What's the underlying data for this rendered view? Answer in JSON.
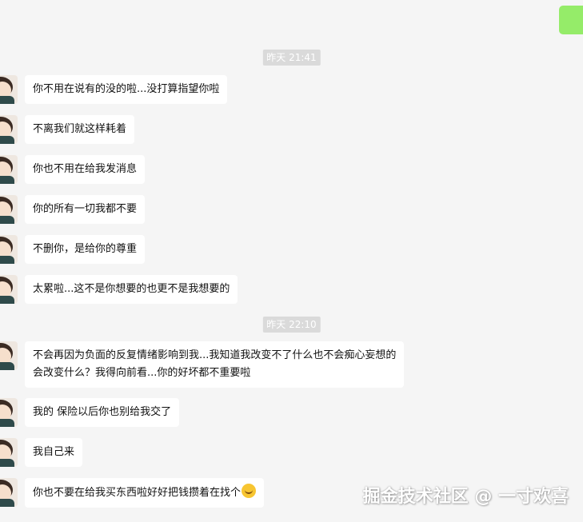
{
  "timestamps": [
    "昨天 21:41",
    "昨天 22:10"
  ],
  "messages": [
    {
      "text": "你不用在说有的没的啦...没打算指望你啦"
    },
    {
      "text": "不离我们就这样耗着"
    },
    {
      "text": "你也不用在给我发消息"
    },
    {
      "text": "你的所有一切我都不要"
    },
    {
      "text": "不删你，是给你的尊重"
    },
    {
      "text": "太累啦...这不是你想要的也更不是我想要的"
    },
    {
      "text": "不会再因为负面的反复情绪影响到我...我知道我改变不了什么也不会痴心妄想的\n会改变什么？我得向前看...你的好坏都不重要啦"
    },
    {
      "text": "我的 保险以后你也别给我交了"
    },
    {
      "text": "我自己来"
    },
    {
      "text": "你也不要在给我买东西啦好好把钱攒着在找个",
      "emoji": "laughing-emoji"
    }
  ],
  "watermark": "掘金技术社区 @ 一寸欢喜",
  "colors": {
    "background": "#f5f5f5",
    "received_bubble": "#ffffff",
    "sent_bubble": "#95ec69",
    "timestamp_bg": "#dadada"
  }
}
